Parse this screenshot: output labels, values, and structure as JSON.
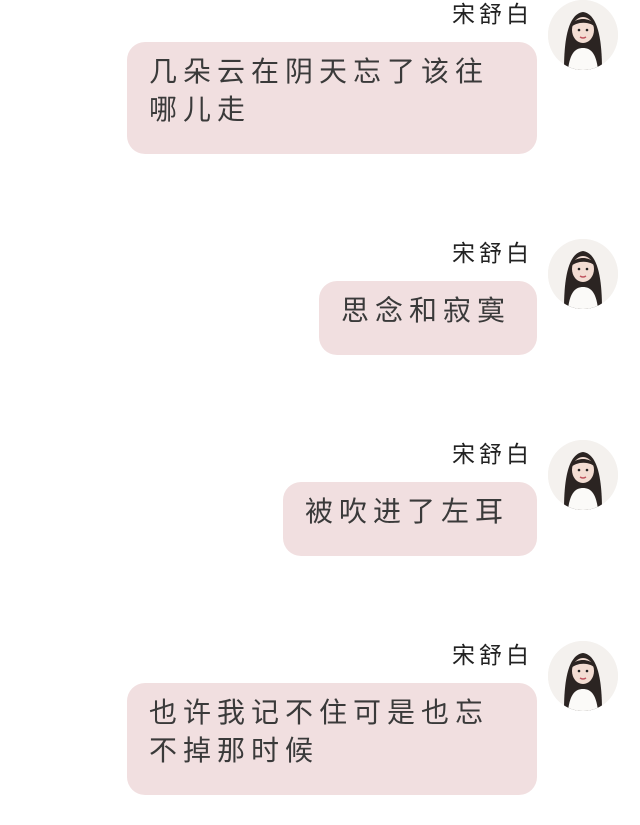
{
  "chat": {
    "messages": [
      {
        "sender": "宋舒白",
        "text": "几朵云在阴天忘了该往哪儿走"
      },
      {
        "sender": "宋舒白",
        "text": "思念和寂寞"
      },
      {
        "sender": "宋舒白",
        "text": "被吹进了左耳"
      },
      {
        "sender": "宋舒白",
        "text": "也许我记不住可是也忘不掉那时候"
      }
    ]
  },
  "colors": {
    "bubble": "#f1dfe0",
    "background": "#ffffff",
    "text": "#3a3a3a"
  },
  "icons": {
    "avatar": "avatar-portrait"
  }
}
